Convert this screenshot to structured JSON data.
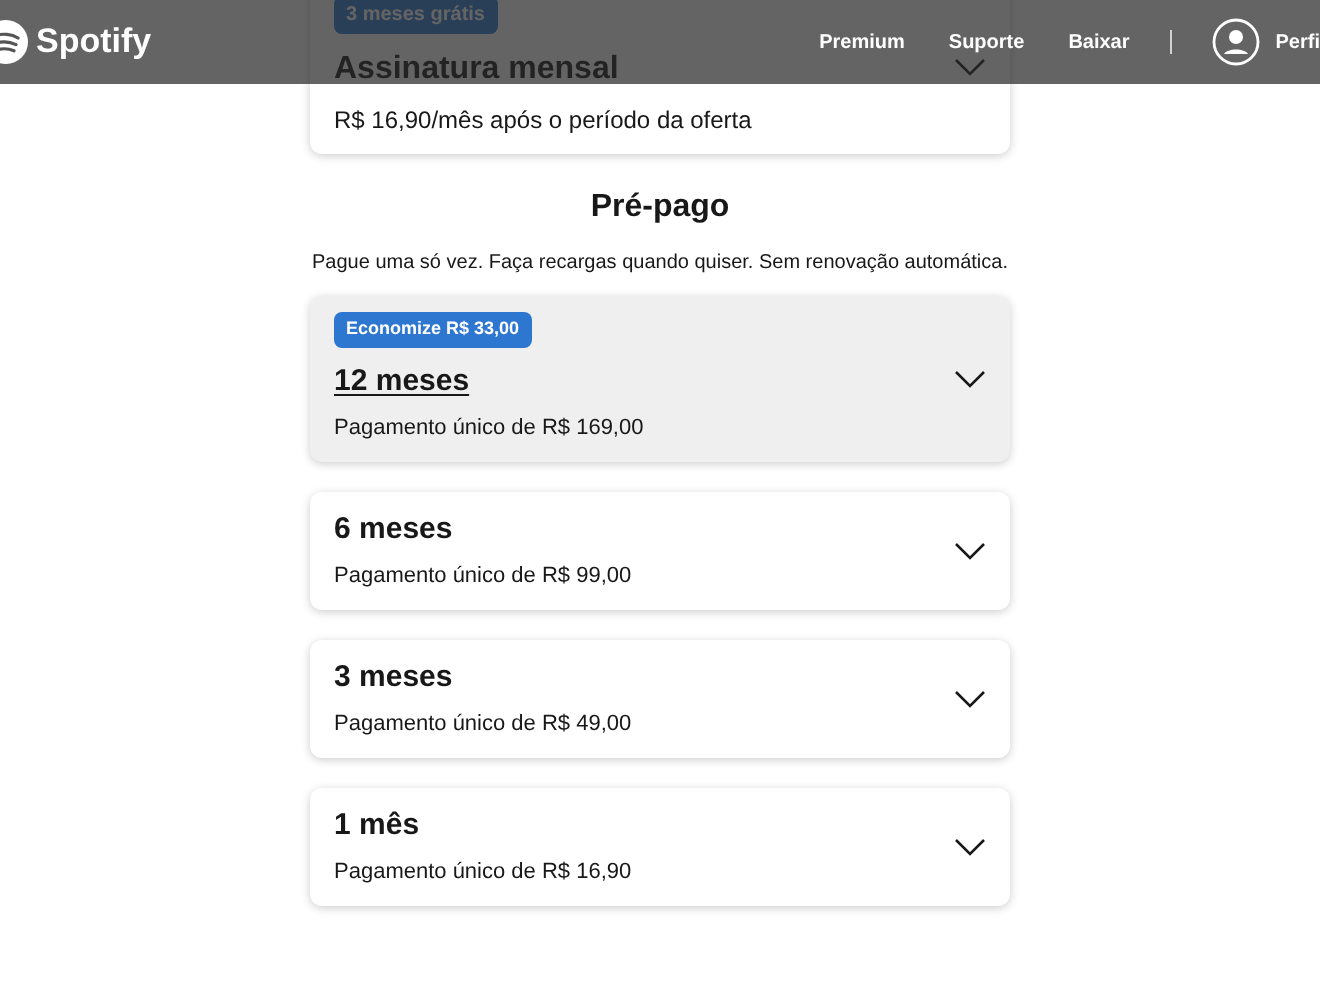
{
  "header": {
    "logo": "Spotify",
    "nav": [
      "Premium",
      "Suporte",
      "Baixar"
    ],
    "profile": "Perfi"
  },
  "monthly": {
    "badge": "3 meses grátis",
    "title": "Assinatura mensal",
    "price": "R$ 16,90/mês após o período da oferta"
  },
  "prepaid": {
    "title": "Pré-pago",
    "subtitle": "Pague uma só vez. Faça recargas quando quiser. Sem renovação automática.",
    "plans": [
      {
        "badge": "Economize R$ 33,00",
        "title": "12 meses",
        "price": "Pagamento único de R$ 169,00",
        "highlighted": true
      },
      {
        "title": "6 meses",
        "price": "Pagamento único de R$ 99,00",
        "highlighted": false
      },
      {
        "title": "3 meses",
        "price": "Pagamento único de R$ 49,00",
        "highlighted": false
      },
      {
        "title": "1 mês",
        "price": "Pagamento único de R$ 16,90",
        "highlighted": false
      }
    ]
  }
}
